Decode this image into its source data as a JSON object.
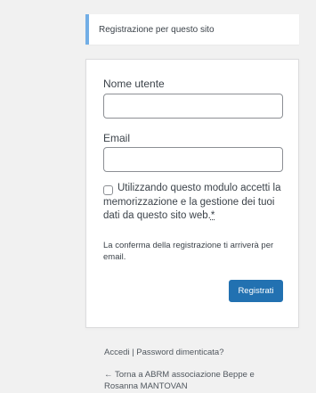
{
  "notice": {
    "message": "Registrazione per questo sito"
  },
  "form": {
    "username_label": "Nome utente",
    "username_value": "",
    "email_label": "Email",
    "email_value": "",
    "consent_checked": false,
    "consent_text": "Utilizzando questo modulo accetti la memorizzazione e la gestione dei tuoi dati da questo sito web.",
    "consent_required_mark": "*",
    "confirmation_text": "La conferma della registrazione ti arriverà per email.",
    "submit_label": "Registrati"
  },
  "nav": {
    "login_link": "Accedi",
    "separator": " | ",
    "lost_password_link": "Password dimenticata?"
  },
  "back_link": {
    "arrow": "← ",
    "label": "Torna a ABRM associazione Beppe e Rosanna MANTOVAN"
  },
  "colors": {
    "background": "#f1f1f1",
    "notice_border": "#72aee6",
    "primary_button": "#2271b1"
  }
}
